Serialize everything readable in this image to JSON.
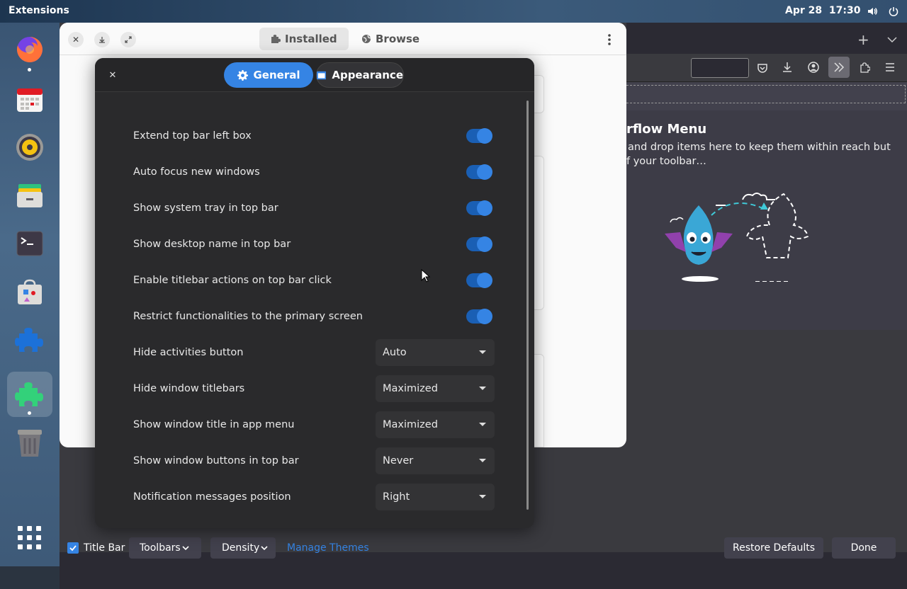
{
  "topbar": {
    "app_name": "Extensions",
    "date": "Apr 28",
    "time": "17:30"
  },
  "dock": {
    "items": [
      {
        "name": "firefox-icon",
        "running": true
      },
      {
        "name": "calendar-icon",
        "running": false
      },
      {
        "name": "rhythmbox-icon",
        "running": false
      },
      {
        "name": "files-icon",
        "running": false
      },
      {
        "name": "terminal-icon",
        "running": false
      },
      {
        "name": "software-icon",
        "running": false
      },
      {
        "name": "extensions-blue-icon",
        "running": false
      },
      {
        "name": "extension-manager-icon",
        "running": true
      },
      {
        "name": "trash-icon",
        "running": false
      },
      {
        "name": "app-grid-icon",
        "running": false
      }
    ]
  },
  "extensions_window": {
    "tabs": [
      {
        "label": "Installed"
      },
      {
        "label": "Browse"
      }
    ]
  },
  "dialog": {
    "tabs": [
      {
        "label": "General"
      },
      {
        "label": "Appearance"
      }
    ],
    "switches": [
      {
        "label": "Extend top bar left box",
        "on": true
      },
      {
        "label": "Auto focus new windows",
        "on": true
      },
      {
        "label": "Show system tray in top bar",
        "on": true
      },
      {
        "label": "Show desktop name in top bar",
        "on": true
      },
      {
        "label": "Enable titlebar actions on top bar click",
        "on": true
      },
      {
        "label": "Restrict functionalities to the primary screen",
        "on": true
      }
    ],
    "dropdowns": [
      {
        "label": "Hide activities button",
        "value": "Auto"
      },
      {
        "label": "Hide window titlebars",
        "value": "Maximized"
      },
      {
        "label": "Show window title in app menu",
        "value": "Maximized"
      },
      {
        "label": "Show window buttons in top bar",
        "value": "Never"
      },
      {
        "label": "Notification messages position",
        "value": "Right"
      }
    ]
  },
  "firefox": {
    "overflow_title": "rflow Menu",
    "overflow_desc_1": "and drop items here to keep them within reach but",
    "overflow_desc_2": "f your toolbar…",
    "bottom": {
      "title_bar_label": "Title Bar",
      "toolbars_label": "Toolbars",
      "density_label": "Density",
      "manage_themes": "Manage Themes",
      "restore_defaults": "Restore Defaults",
      "done": "Done"
    }
  },
  "colors": {
    "accent": "#3584e4",
    "dialog_bg": "#2a2a2c",
    "link": "#3584e4"
  }
}
